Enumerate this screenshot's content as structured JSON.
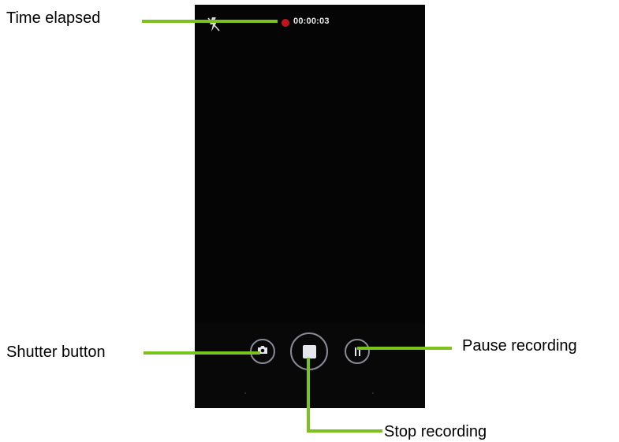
{
  "recording": {
    "timer": "00:00:03"
  },
  "callouts": {
    "time_elapsed": "Time elapsed",
    "shutter_button": "Shutter button",
    "pause_recording": "Pause recording",
    "stop_recording": "Stop recording"
  },
  "icons": {
    "flash": "flash-off-icon",
    "record_indicator": "record-dot-icon",
    "shutter": "camera-icon",
    "stop": "stop-icon",
    "pause": "pause-icon"
  },
  "colors": {
    "callout_line": "#7cc21f",
    "record_dot": "#c0151b",
    "screen_background": "#050505"
  }
}
